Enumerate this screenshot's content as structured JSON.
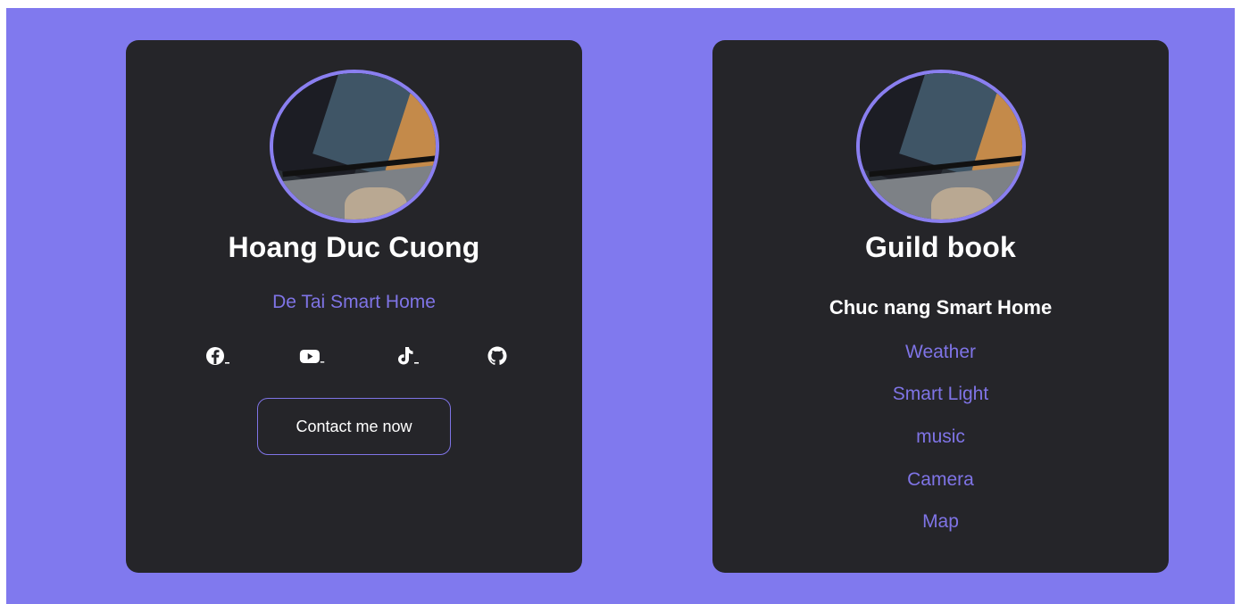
{
  "colors": {
    "background": "#8079ee",
    "card": "#252529",
    "accent": "#7f74e6",
    "text": "#ffffff"
  },
  "profile_card": {
    "name": "Hoang Duc Cuong",
    "subtitle": "De Tai Smart Home",
    "socials": [
      {
        "icon": "facebook-icon"
      },
      {
        "icon": "youtube-icon"
      },
      {
        "icon": "tiktok-icon"
      },
      {
        "icon": "github-icon"
      }
    ],
    "contact_label": "Contact me now"
  },
  "guide_card": {
    "title": "Guild book",
    "section_title": "Chuc nang Smart Home",
    "features": [
      "Weather",
      "Smart Light",
      "music",
      "Camera",
      "Map"
    ]
  }
}
